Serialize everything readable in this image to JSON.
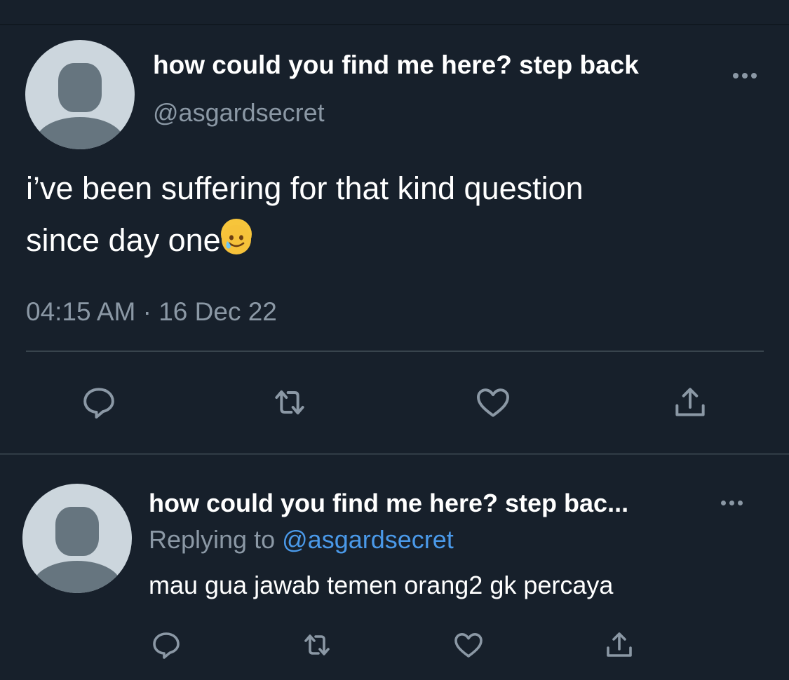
{
  "main_tweet": {
    "display_name": "how could you find me here? step back",
    "handle": "@asgardsecret",
    "text_line1": "i’ve been suffering for that kind question",
    "text_line2": "since day one",
    "emoji_icon": "face-holding-back-tears-emoji",
    "timestamp": "04:15 AM · 16 Dec 22",
    "actions": [
      "reply-icon",
      "retweet-icon",
      "like-icon",
      "share-icon"
    ]
  },
  "reply_tweet": {
    "display_name": "how could you find me here? step bac...",
    "replying_to_label": "Replying to",
    "replying_to_handle": "@asgardsecret",
    "text": "mau gua jawab temen orang2 gk percaya",
    "actions": [
      "reply-icon",
      "retweet-icon",
      "like-icon",
      "share-icon"
    ]
  },
  "colors": {
    "background": "#17202b",
    "text_primary": "#ffffff",
    "text_secondary": "#8b98a5",
    "link": "#4a99e9",
    "divider": "#38444d",
    "icon": "#8b98a5"
  }
}
